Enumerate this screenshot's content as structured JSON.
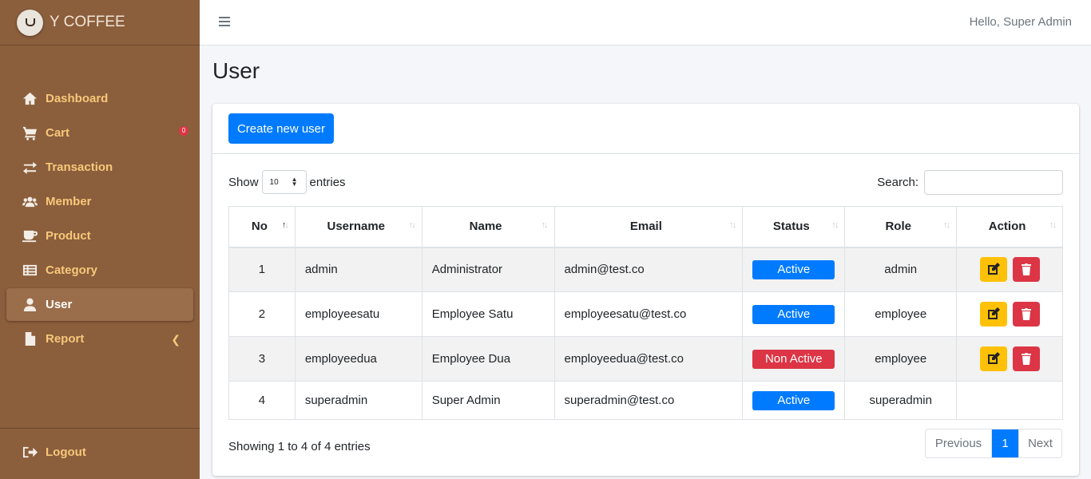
{
  "brand": {
    "name": "Y COFFEE"
  },
  "sidebar": {
    "items": [
      {
        "label": "Dashboard",
        "icon": "home-icon"
      },
      {
        "label": "Cart",
        "icon": "cart-icon",
        "badge": "0"
      },
      {
        "label": "Transaction",
        "icon": "exchange-icon"
      },
      {
        "label": "Member",
        "icon": "users-icon"
      },
      {
        "label": "Product",
        "icon": "mug-icon"
      },
      {
        "label": "Category",
        "icon": "list-icon"
      },
      {
        "label": "User",
        "icon": "user-icon",
        "active": true
      },
      {
        "label": "Report",
        "icon": "file-icon"
      }
    ],
    "logout_label": "Logout"
  },
  "topbar": {
    "greeting": "Hello, Super Admin"
  },
  "page": {
    "title": "User"
  },
  "toolbar": {
    "create_label": "Create new user"
  },
  "table_controls": {
    "show_label": "Show",
    "entries_label": "entries",
    "page_length": "10",
    "search_label": "Search:",
    "search_value": ""
  },
  "table": {
    "columns": [
      "No",
      "Username",
      "Name",
      "Email",
      "Status",
      "Role",
      "Action"
    ],
    "rows": [
      {
        "no": "1",
        "username": "admin",
        "name": "Administrator",
        "email": "admin@test.co",
        "status": "Active",
        "role": "admin"
      },
      {
        "no": "2",
        "username": "employeesatu",
        "name": "Employee Satu",
        "email": "employeesatu@test.co",
        "status": "Active",
        "role": "employee"
      },
      {
        "no": "3",
        "username": "employeedua",
        "name": "Employee Dua",
        "email": "employeedua@test.co",
        "status": "Non Active",
        "role": "employee"
      },
      {
        "no": "4",
        "username": "superadmin",
        "name": "Super Admin",
        "email": "superadmin@test.co",
        "status": "Active",
        "role": "superadmin"
      }
    ]
  },
  "footer": {
    "info": "Showing 1 to 4 of 4 entries",
    "prev_label": "Previous",
    "page_label": "1",
    "next_label": "Next"
  },
  "colors": {
    "sidebar": "#8b5e3c",
    "accent": "#007bff",
    "danger": "#dc3545",
    "warning": "#ffc107",
    "nav_text": "#f7c87a"
  }
}
